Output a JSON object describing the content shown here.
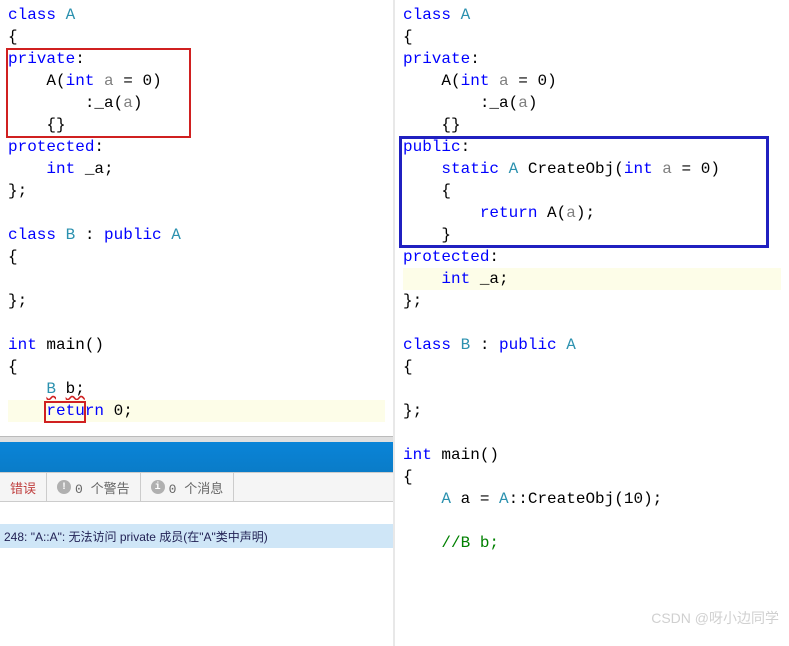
{
  "left": {
    "code": {
      "l1_class": "class",
      "l1_A": "A",
      "l2": "{",
      "l3_private": "private",
      "l4_ctor": "A",
      "l4_int": "int",
      "l4_param": "a",
      "l4_eq": " = ",
      "l4_zero": "0",
      "l5_init": ":_a(",
      "l5_a": "a",
      "l5_close": ")",
      "l6": "{}",
      "l7_protected": "protected",
      "l8_int": "int",
      "l8_member": "_a;",
      "l9": "};",
      "l11_class": "class",
      "l11_B": "B",
      "l11_colon": " : ",
      "l11_public": "public",
      "l11_A": "A",
      "l12": "{",
      "l14": "};",
      "l16_int": "int",
      "l16_main": "main()",
      "l17": "{",
      "l18_B": "B",
      "l18_b": "b;",
      "l19_return": "return",
      "l19_zero": "0",
      "l19_semi": ";"
    },
    "status": {
      "errors_label": "错误",
      "warnings_icon": "!",
      "warnings_text": "0 个警告",
      "messages_icon": "i",
      "messages_text": "0 个消息",
      "error_msg": "248: \"A::A\": 无法访问 private 成员(在\"A\"类中声明)"
    }
  },
  "right": {
    "code": {
      "l1_class": "class",
      "l1_A": "A",
      "l2": "{",
      "l3_private": "private",
      "l4_ctor": "A",
      "l4_int": "int",
      "l4_param": "a",
      "l4_eq": " = ",
      "l4_zero": "0",
      "l5_init": ":_a(",
      "l5_a": "a",
      "l5_close": ")",
      "l6": "{}",
      "l7_public": "public",
      "l8_static": "static",
      "l8_A": "A",
      "l8_fn": "CreateObj(",
      "l8_int": "int",
      "l8_param": "a",
      "l8_eq": " = ",
      "l8_zero": "0",
      "l8_close": ")",
      "l9": "{",
      "l10_return": "return",
      "l10_A": "A",
      "l10_open": "(",
      "l10_a": "a",
      "l10_close": ");",
      "l11": "}",
      "l12_protected": "protected",
      "l13_int": "int",
      "l13_member": "_a;",
      "l14": "};",
      "l16_class": "class",
      "l16_B": "B",
      "l16_colon": " : ",
      "l16_public": "public",
      "l16_A": "A",
      "l17": "{",
      "l19": "};",
      "l21_int": "int",
      "l21_main": "main()",
      "l22": "{",
      "l23_A1": "A",
      "l23_a": "a = ",
      "l23_A2": "A",
      "l23_call": "::CreateObj(10);",
      "l25_comment": "//B b;"
    }
  },
  "watermark": "CSDN @呀小边同学"
}
